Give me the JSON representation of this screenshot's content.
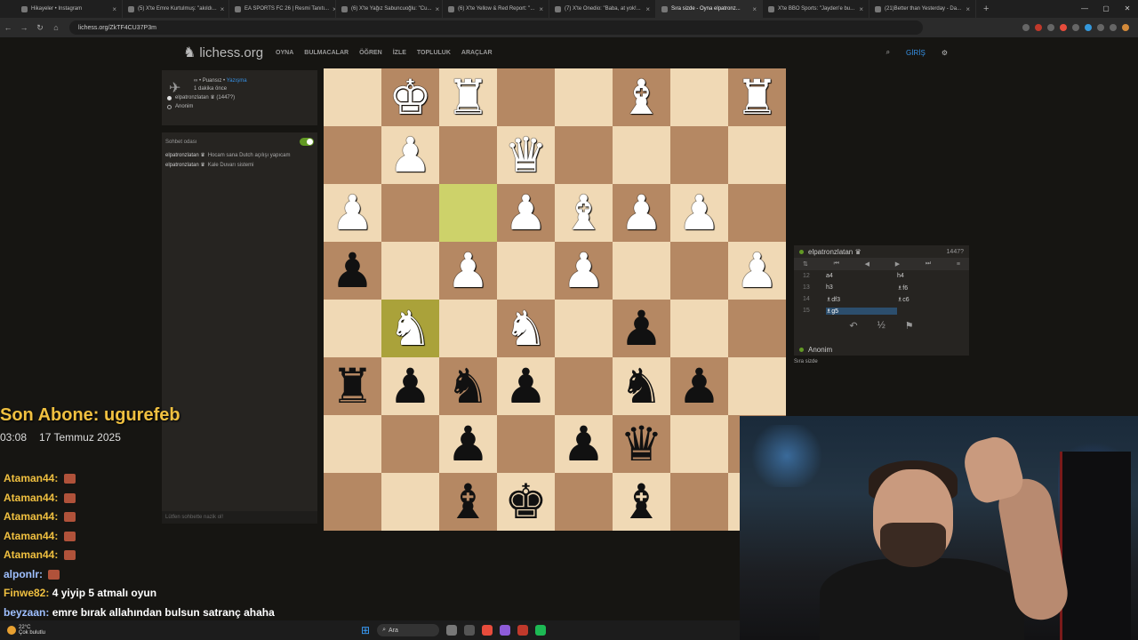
{
  "browser": {
    "tabs": [
      {
        "label": "Hikayeler • Instagram",
        "active": false
      },
      {
        "label": "(5) X'te Emre Kurtulmuş: \"akıldı...",
        "active": false
      },
      {
        "label": "EA SPORTS FC 26 | Resmi Tanıtı...",
        "active": false
      },
      {
        "label": "(6) X'te Yağız Sabuncuoğlu: \"Cu...",
        "active": false
      },
      {
        "label": "(6) X'te Yellow & Red Report: \"...",
        "active": false
      },
      {
        "label": "(7) X'te Onedio: \"Baba, at yok!...",
        "active": false
      },
      {
        "label": "Sıra sizde - Oyna elpatronz...",
        "active": true
      },
      {
        "label": "X'te BBO Sports: \"Jayden'e bu...",
        "active": false
      },
      {
        "label": "(21)Better than Yesterday - Da...",
        "active": false
      }
    ],
    "new_tab": "+",
    "url": "lichess.org/ZkTF4CU37P3m"
  },
  "site": {
    "logo_text": "lichess.org",
    "nav": [
      "OYNA",
      "BULMACALAR",
      "ÖĞREN",
      "İZLE",
      "TOPLULUK",
      "ARAÇLAR"
    ],
    "login": "GİRİŞ"
  },
  "game_info": {
    "line1_prefix": "∞ • Puansız • ",
    "line1_type": "Yazışma",
    "line2": "1 dakika önce",
    "white_player": "elpatronzlatan ♛ (1447?)",
    "black_player": "Anonim"
  },
  "chat": {
    "title": "Sohbet odası",
    "messages": [
      {
        "user": "elpatronzlatan ♛",
        "text": "Hocam sana Dutch açılışı yapıcam"
      },
      {
        "user": "elpatronzlatan ♛",
        "text": "Kale Duvarı sistemi"
      }
    ],
    "placeholder": "Lütfen sohbette nazik ol!"
  },
  "board": {
    "ranks": [
      [
        "",
        "wK",
        "wR",
        "",
        "",
        "wB",
        "",
        "wR"
      ],
      [
        "",
        "wP",
        "",
        "wQ",
        "",
        "",
        "",
        ""
      ],
      [
        "wP",
        "",
        "",
        "wP",
        "wB",
        "wP",
        "wP",
        ""
      ],
      [
        "bP",
        "",
        "wP",
        "",
        "wP",
        "",
        "",
        "wP"
      ],
      [
        "",
        "wN",
        "",
        "wN",
        "",
        "bP",
        "",
        ""
      ],
      [
        "bR",
        "bP",
        "bN",
        "bP",
        "",
        "bN",
        "bP",
        ""
      ],
      [
        "",
        "",
        "bP",
        "",
        "bP",
        "bQ",
        "",
        ""
      ],
      [
        "",
        "",
        "bB",
        "bK",
        "",
        "bB",
        "",
        ""
      ]
    ],
    "highlights": [
      "2-2",
      "4-1"
    ]
  },
  "moves_panel": {
    "top_player": "elpatronzlatan ♛",
    "top_rating": "1447?",
    "moves": [
      {
        "n": "12",
        "white": "a4",
        "black": "h4"
      },
      {
        "n": "13",
        "white": "h3",
        "black": "♗f6"
      },
      {
        "n": "14",
        "white": "♗df3",
        "black": "♗c6"
      },
      {
        "n": "15",
        "white": "♗g5",
        "black": ""
      }
    ],
    "bottom_player": "Anonim",
    "status": "Sıra sizde"
  },
  "stream": {
    "last_sub": "Son Abone: ugurefeb",
    "time": "03:08",
    "date": "17 Temmuz 2025",
    "chat": [
      {
        "user": "Ataman44:",
        "text": "",
        "emote": true,
        "color": "gold"
      },
      {
        "user": "Ataman44:",
        "text": "",
        "emote": true,
        "color": "gold"
      },
      {
        "user": "Ataman44:",
        "text": "",
        "emote": true,
        "color": "gold"
      },
      {
        "user": "Ataman44:",
        "text": "",
        "emote": true,
        "color": "gold"
      },
      {
        "user": "Ataman44:",
        "text": "",
        "emote": true,
        "color": "gold"
      },
      {
        "user": "alponlr:",
        "text": "",
        "emote": true,
        "color": "blue"
      },
      {
        "user": "Finwe82:",
        "text": "4 yiyip 5 atmalı oyun",
        "emote": false,
        "color": "gold"
      },
      {
        "user": "beyzaan:",
        "text": "emre bırak allahından bulsun satranç ahaha",
        "emote": false,
        "color": "blue"
      }
    ]
  },
  "taskbar": {
    "temp": "22°C",
    "weather": "Çok bulutlu",
    "search": "Ara"
  },
  "colors": {
    "board_light": "#f0d9b5",
    "board_dark": "#b58863",
    "accent": "#3692e7",
    "sub_highlight": "#f0c040"
  }
}
